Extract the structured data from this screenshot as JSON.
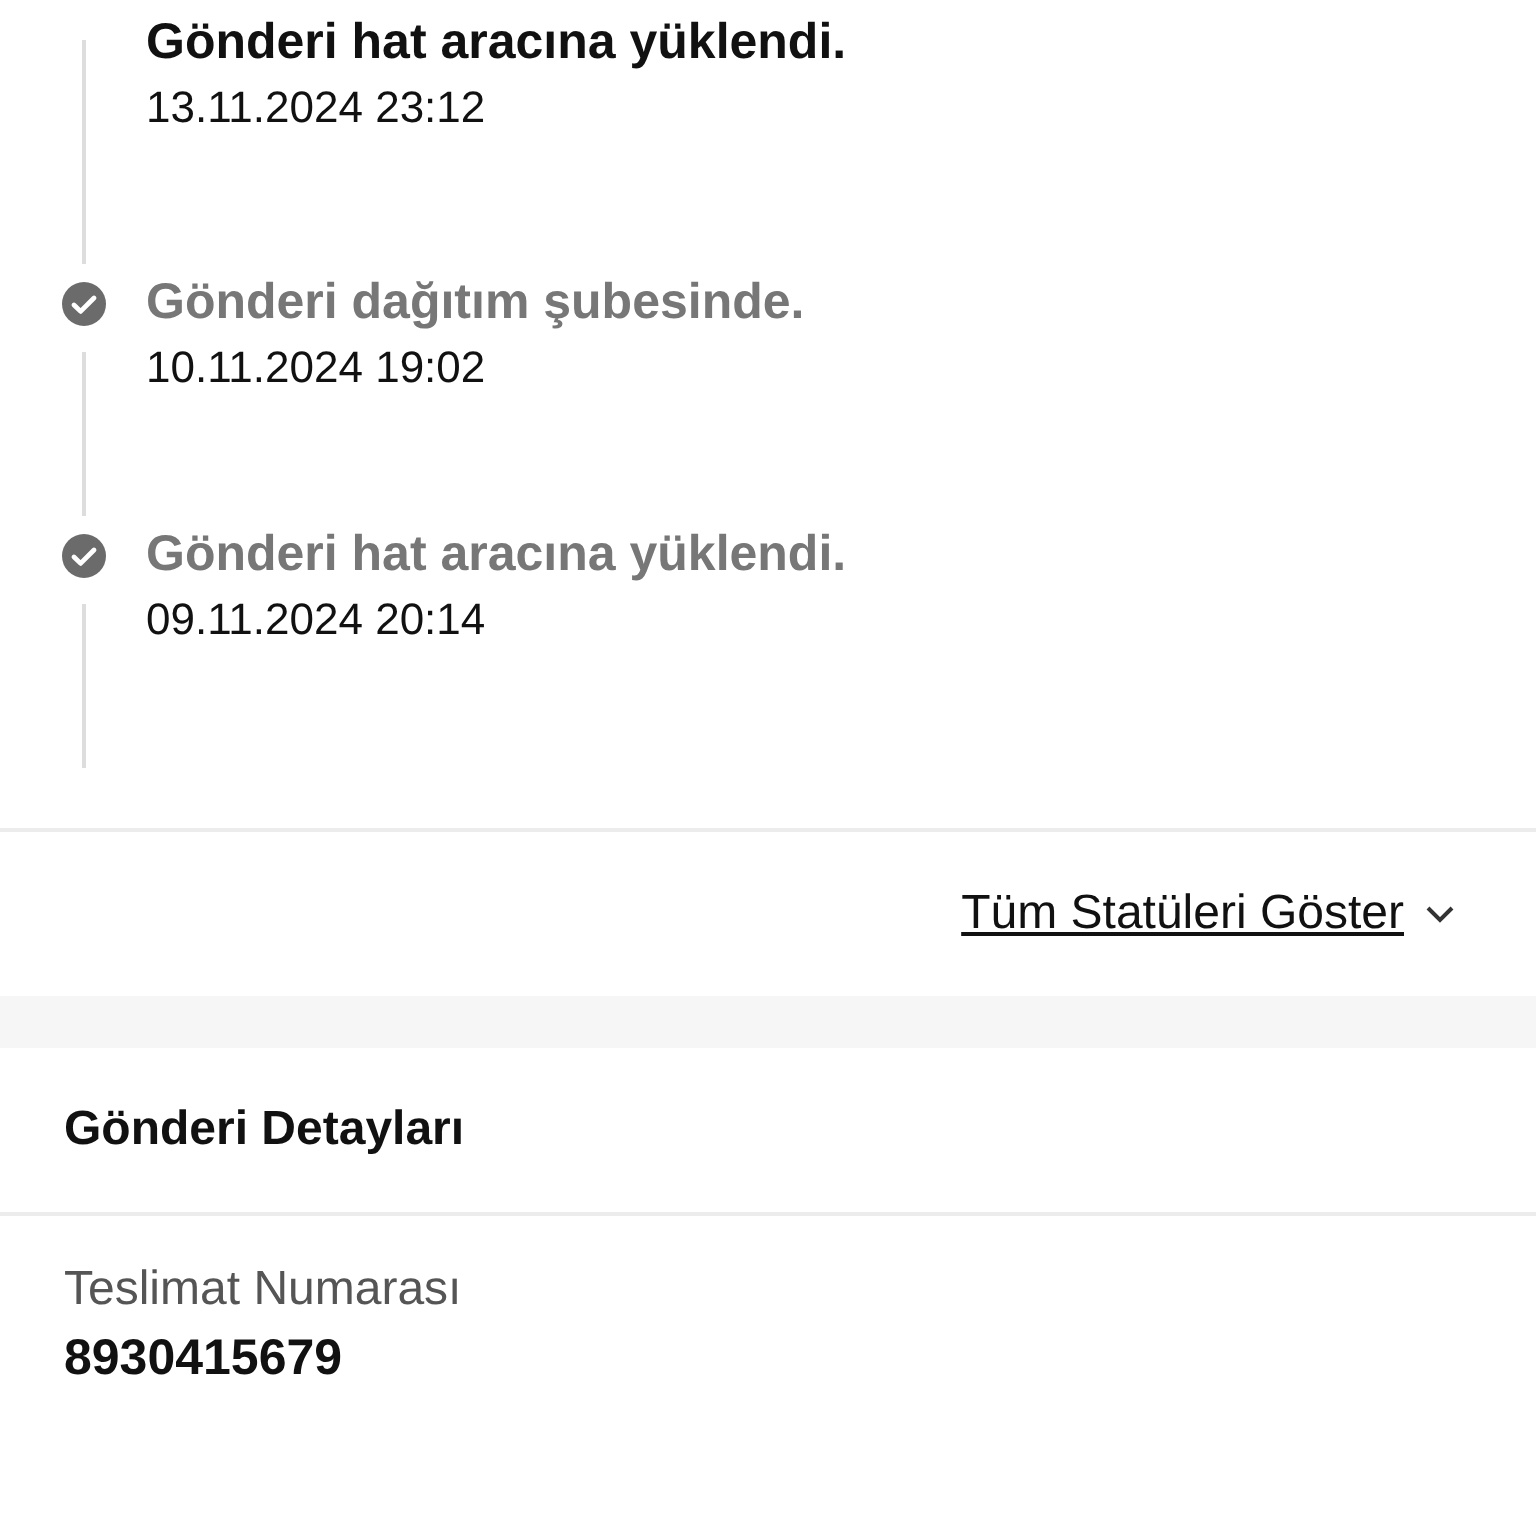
{
  "timeline": [
    {
      "title": "Gönderi hat aracına yüklendi.",
      "time": "13.11.2024 23:12",
      "current": true
    },
    {
      "title": "Gönderi dağıtım şubesinde.",
      "time": "10.11.2024 19:02",
      "current": false
    },
    {
      "title": "Gönderi hat aracına yüklendi.",
      "time": "09.11.2024 20:14",
      "current": false
    }
  ],
  "show_all_link": "Tüm Statüleri Göster",
  "details": {
    "title": "Gönderi Detayları",
    "fields": [
      {
        "label": "Teslimat Numarası",
        "value": "8930415679"
      }
    ]
  }
}
